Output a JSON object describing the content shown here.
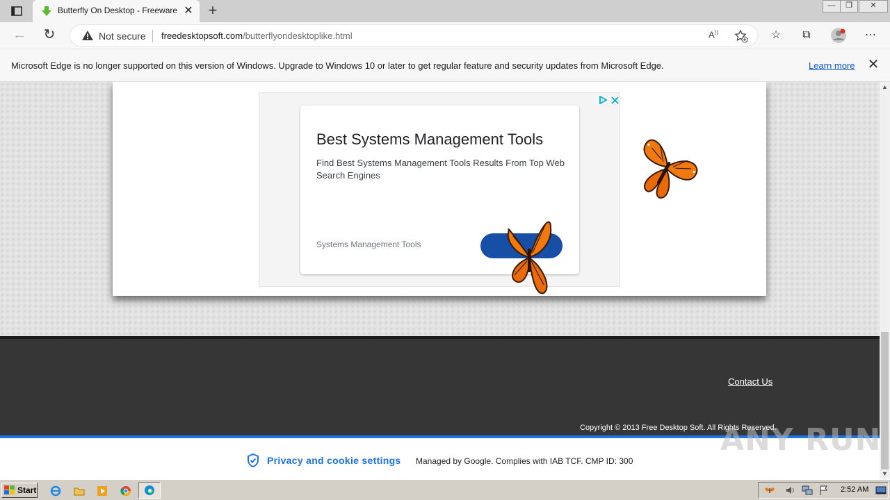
{
  "browser": {
    "tab": {
      "title": "Butterfly On Desktop - Freeware :"
    },
    "window_controls": {
      "minimize": "—",
      "restore": "❐",
      "close": "✕"
    },
    "address": {
      "security_label": "Not secure",
      "url_host": "freedesktopsoft.com",
      "url_path": "/butterflyondesktoplike.html"
    },
    "infobar": {
      "message": "Microsoft Edge is no longer supported on this version of Windows. Upgrade to Windows 10 or later to get regular feature and security updates from Microsoft Edge.",
      "learn_more": "Learn more"
    }
  },
  "page": {
    "ad": {
      "title": "Best Systems Management Tools",
      "description": "Find Best Systems Management Tools Results From Top Web Search Engines",
      "source": "Systems Management Tools"
    },
    "footer": {
      "contact": "Contact Us",
      "copyright": "Copyright © 2013 Free Desktop Soft. All Rights Reserved."
    },
    "consent": {
      "privacy_link": "Privacy and cookie settings",
      "managed_text": "Managed by Google. Complies with IAB TCF. CMP ID: 300"
    },
    "watermark": "ANY RUN"
  },
  "taskbar": {
    "start": "Start",
    "clock": "2:52 AM"
  },
  "colors": {
    "accent_blue": "#1a73e8",
    "butterfly_orange": "#f07a10",
    "footer_dark": "#363636",
    "ad_button": "#174ea6"
  }
}
